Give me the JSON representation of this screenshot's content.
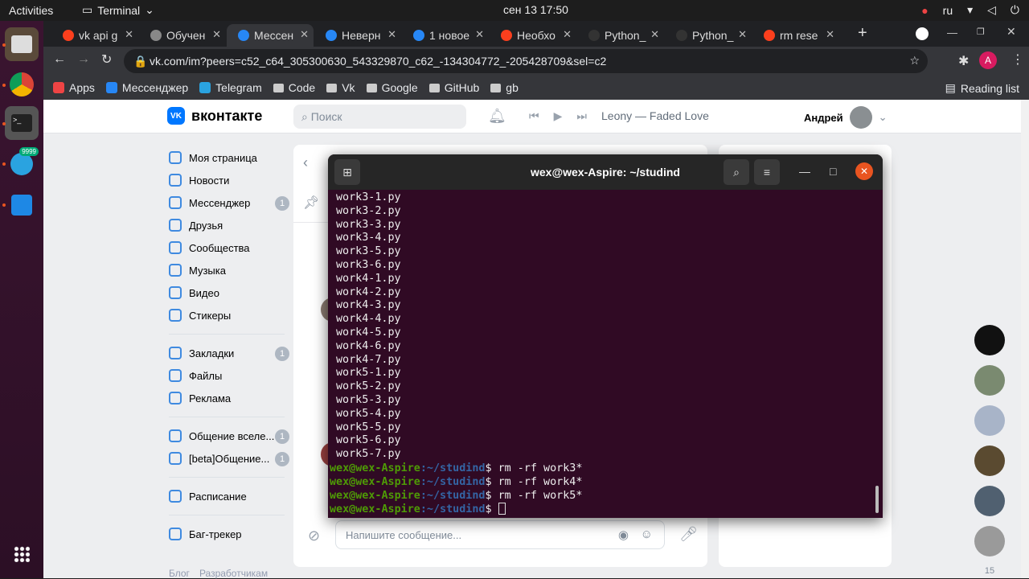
{
  "topbar": {
    "activities": "Activities",
    "app": "Terminal",
    "clock": "сен 13  17:50",
    "lang": "ru"
  },
  "tabs": [
    {
      "label": "vk api g",
      "color": "#fc3f1d"
    },
    {
      "label": "Обучен",
      "color": "#888888"
    },
    {
      "label": "Мессен",
      "color": "#2787f5"
    },
    {
      "label": "Неверн",
      "color": "#2787f5"
    },
    {
      "label": "1 новое",
      "color": "#2787f5"
    },
    {
      "label": "Необхо",
      "color": "#fc3f1d"
    },
    {
      "label": "Python_",
      "color": "#333333"
    },
    {
      "label": "Python_",
      "color": "#333333"
    },
    {
      "label": "rm rese",
      "color": "#fc3f1d"
    }
  ],
  "address": "vk.com/im?peers=c52_c64_305300630_543329870_c62_-134304772_-205428709&sel=c2",
  "bookmarks": [
    "Apps",
    "Мессенджер",
    "Telegram",
    "Code",
    "Vk",
    "Google",
    "GitHub",
    "gb"
  ],
  "reading_list": "Reading list",
  "vk": {
    "logo": "вконтакте",
    "search": "Поиск",
    "track": "Leony — Faded Love",
    "user": "Андрей",
    "compose": "Напишите сообщение...",
    "nav": [
      {
        "label": "Моя страница",
        "badge": ""
      },
      {
        "label": "Новости",
        "badge": ""
      },
      {
        "label": "Мессенджер",
        "badge": "1"
      },
      {
        "label": "Друзья",
        "badge": ""
      },
      {
        "label": "Сообщества",
        "badge": ""
      },
      {
        "label": "Музыка",
        "badge": ""
      },
      {
        "label": "Видео",
        "badge": ""
      },
      {
        "label": "Стикеры",
        "badge": ""
      }
    ],
    "nav2": [
      {
        "label": "Закладки",
        "badge": "1"
      },
      {
        "label": "Файлы",
        "badge": ""
      },
      {
        "label": "Реклама",
        "badge": ""
      }
    ],
    "nav3": [
      {
        "label": "Общение вселе...",
        "badge": "1"
      },
      {
        "label": "[beta]Общение...",
        "badge": "1"
      }
    ],
    "nav4": [
      {
        "label": "Расписание",
        "badge": ""
      }
    ],
    "nav5": [
      {
        "label": "Баг-трекер",
        "badge": ""
      }
    ],
    "footer": [
      "Блог",
      "Разработчикам"
    ],
    "online_count": "15"
  },
  "terminal": {
    "title": "wex@wex-Aspire: ~/studind",
    "lines": [
      "work3-1.py",
      "work3-2.py",
      "work3-3.py",
      "work3-4.py",
      "work3-5.py",
      "work3-6.py",
      "work4-1.py",
      "work4-2.py",
      "work4-3.py",
      "work4-4.py",
      "work4-5.py",
      "work4-6.py",
      "work4-7.py",
      "work5-1.py",
      "work5-2.py",
      "work5-3.py",
      "work5-4.py",
      "work5-5.py",
      "work5-6.py",
      "work5-7.py"
    ],
    "prompt_user": "wex@wex-Aspire",
    "prompt_path": ":~/studind",
    "commands": [
      "rm -rf work3*",
      "rm -rf work4*",
      "rm -rf work5*",
      ""
    ]
  },
  "telegram_badge": "9999"
}
